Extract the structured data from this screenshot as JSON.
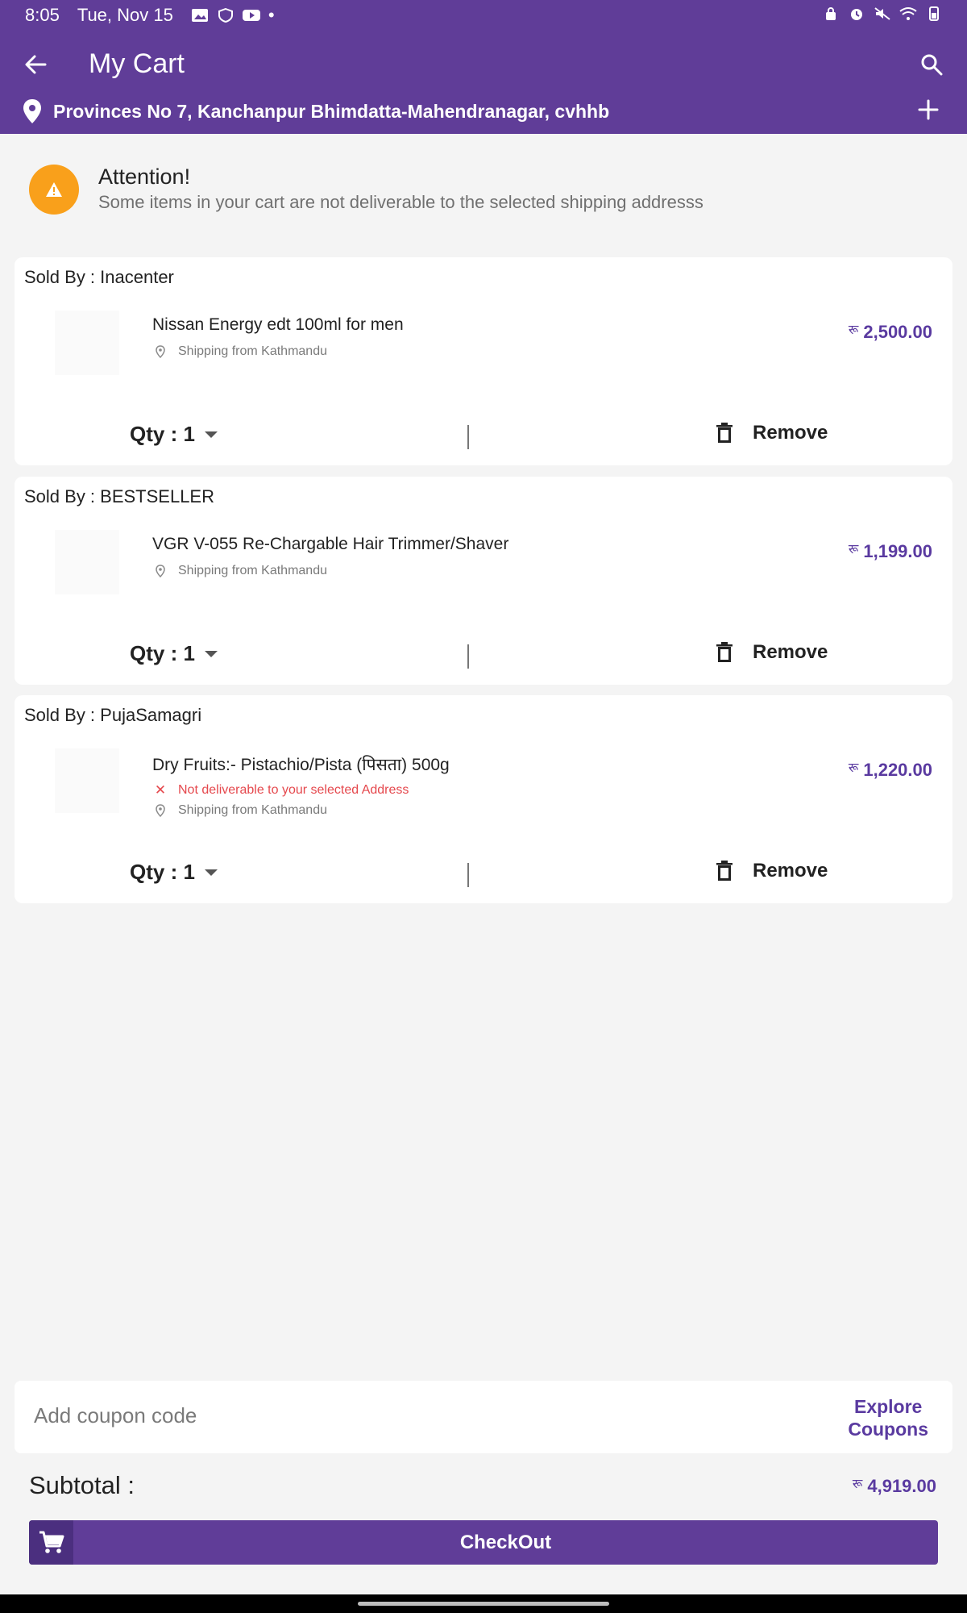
{
  "status_bar": {
    "time": "8:05",
    "date": "Tue, Nov 15",
    "dot": "•"
  },
  "header": {
    "title": "My Cart",
    "location": "Provinces No 7,  Kanchanpur Bhimdatta-Mahendranagar, cvhhb"
  },
  "attention": {
    "title": "Attention!",
    "message": "Some items in your cart are not deliverable to the selected shipping addresss"
  },
  "cart_items": [
    {
      "seller": "Sold By : Inacenter",
      "product": "Nissan Energy edt 100ml for men",
      "not_deliverable": "",
      "shipping": "Shipping from Kathmandu",
      "currency": "रू",
      "price": "2,500.00",
      "qty": "Qty : 1",
      "remove": "Remove"
    },
    {
      "seller": "Sold By : BESTSELLER",
      "product": "VGR V-055 Re-Chargable Hair Trimmer/Shaver",
      "not_deliverable": "",
      "shipping": "Shipping from Kathmandu",
      "currency": "रू",
      "price": "1,199.00",
      "qty": "Qty : 1",
      "remove": "Remove"
    },
    {
      "seller": "Sold By : PujaSamagri",
      "product": "Dry Fruits:- Pistachio/Pista (पिसता) 500g",
      "not_deliverable": "Not deliverable to your selected Address",
      "shipping": "Shipping from Kathmandu",
      "currency": "रू",
      "price": "1,220.00",
      "qty": "Qty : 1",
      "remove": "Remove"
    }
  ],
  "coupon": {
    "placeholder": "Add coupon code",
    "explore_line1": "Explore",
    "explore_line2": "Coupons"
  },
  "subtotal": {
    "label": "Subtotal :",
    "currency": "रू",
    "value": "4,919.00"
  },
  "checkout": {
    "label": "CheckOut"
  },
  "colors": {
    "primary": "#603d98",
    "accent_price": "#5a3aa0",
    "warning": "#f9a01b",
    "error": "#e5484d",
    "background": "#f4f4f4"
  }
}
